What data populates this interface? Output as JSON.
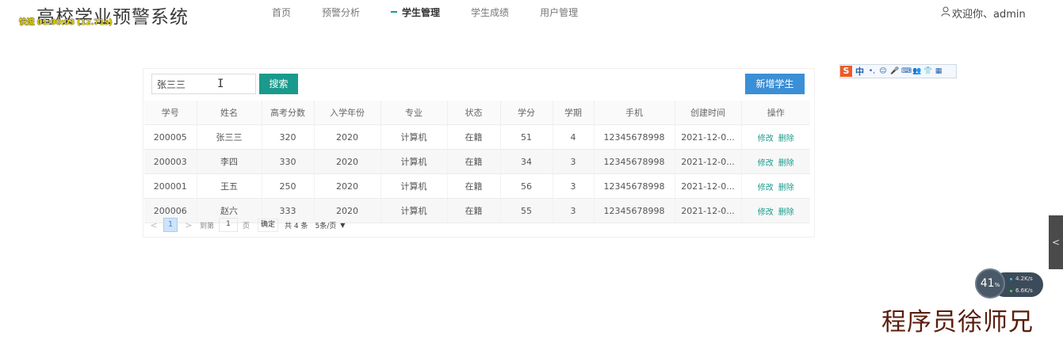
{
  "app": {
    "title": "高校学业预警系统",
    "overlay_tag": "快进 01:00:03 (12.71s)"
  },
  "nav": {
    "items": [
      {
        "label": "首页",
        "active": false
      },
      {
        "label": "预警分析",
        "active": false
      },
      {
        "label": "学生管理",
        "active": true
      },
      {
        "label": "学生成绩",
        "active": false
      },
      {
        "label": "用户管理",
        "active": false
      }
    ]
  },
  "user": {
    "greeting": "欢迎你、admin"
  },
  "search": {
    "value": "张三三",
    "button_label": "搜索"
  },
  "toolbar": {
    "add_label": "新增学生"
  },
  "table": {
    "columns": [
      "学号",
      "姓名",
      "高考分数",
      "入学年份",
      "专业",
      "状态",
      "学分",
      "学期",
      "手机",
      "创建时间",
      "操作"
    ],
    "rows": [
      [
        "200005",
        "张三三",
        "320",
        "2020",
        "计算机",
        "在籍",
        "51",
        "4",
        "12345678998",
        "2021-12-0..."
      ],
      [
        "200003",
        "李四",
        "330",
        "2020",
        "计算机",
        "在籍",
        "34",
        "3",
        "12345678998",
        "2021-12-0..."
      ],
      [
        "200001",
        "王五",
        "250",
        "2020",
        "计算机",
        "在籍",
        "56",
        "3",
        "12345678998",
        "2021-12-0..."
      ],
      [
        "200006",
        "赵六",
        "333",
        "2020",
        "计算机",
        "在籍",
        "55",
        "3",
        "12345678998",
        "2021-12-0..."
      ]
    ],
    "actions": {
      "edit": "修改",
      "delete": "删除"
    }
  },
  "pager": {
    "prev": "<",
    "current_page": "1",
    "next": ">",
    "goto_label": "到第",
    "goto_value": "1",
    "page_unit": "页",
    "confirm": "确定",
    "total": "共 4 条",
    "page_size": "5条/页"
  },
  "ime": {
    "logo": "S",
    "lang": "中",
    "icons": [
      "•,",
      "☺",
      "🎤",
      "⌨",
      "👥",
      "👕",
      "▦"
    ]
  },
  "side_handle": {
    "label": "<"
  },
  "speed_widget": {
    "percent": "41",
    "percent_unit": "%",
    "up": "4.2",
    "up_unit": "K/s",
    "down": "6.6",
    "down_unit": "K/s",
    "up_color": "#2fc4d6",
    "down_color": "#4cd964"
  },
  "watermark": "程序员徐师兄",
  "colors": {
    "accent": "#1a9a8c",
    "primary": "#3b8fd6"
  }
}
